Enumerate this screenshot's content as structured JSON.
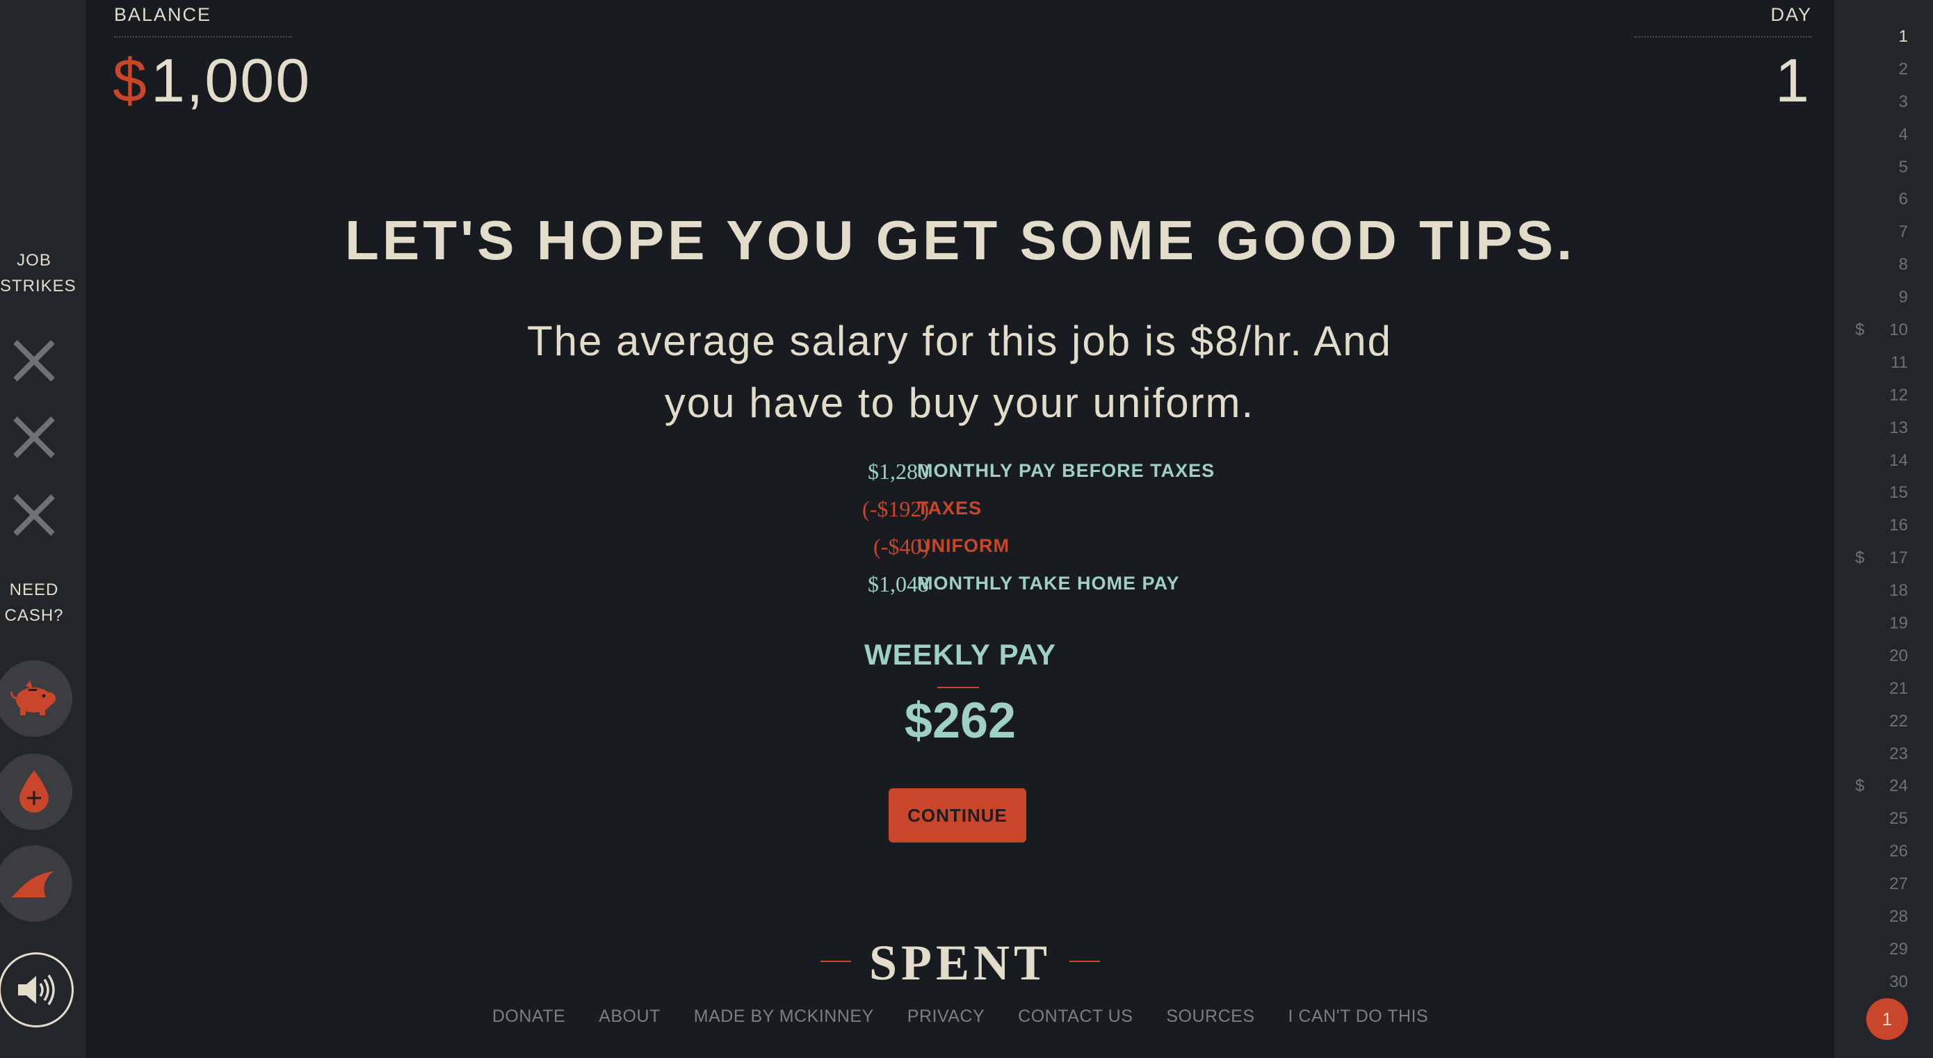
{
  "header": {
    "balance_label": "BALANCE",
    "balance_currency": "$",
    "balance_value": "1,000",
    "day_label": "DAY",
    "day_value": "1"
  },
  "left_rail": {
    "job_strikes_label": "JOB STRIKES",
    "strike_icons": [
      "x-icon",
      "x-icon",
      "x-icon"
    ],
    "need_cash_label": "NEED CASH?",
    "cash_buttons": [
      "piggy-bank-icon",
      "blood-drop-plus-icon",
      "shark-fin-icon"
    ],
    "sound_icon": "speaker-icon"
  },
  "main": {
    "headline": "LET'S HOPE YOU GET SOME GOOD TIPS.",
    "subhead": "The average salary for this job is $8/hr. And you have to buy your uniform.",
    "ledger": [
      {
        "amount": "$1,280",
        "label": "MONTHLY PAY BEFORE TAXES",
        "tone": "teal"
      },
      {
        "amount": "(-$192)",
        "label": "TAXES",
        "tone": "rust"
      },
      {
        "amount": "(-$40)",
        "label": "UNIFORM",
        "tone": "rust"
      },
      {
        "amount": "$1,048",
        "label": "MONTHLY TAKE HOME PAY",
        "tone": "teal"
      }
    ],
    "weekly_label": "WEEKLY PAY",
    "weekly_value": "$262",
    "continue_label": "CONTINUE"
  },
  "logo": "SPENT",
  "footer_links": [
    "DONATE",
    "ABOUT",
    "MADE BY MCKINNEY",
    "PRIVACY",
    "CONTACT US",
    "SOURCES",
    "I CAN'T DO THIS"
  ],
  "days": {
    "items": [
      "1",
      "2",
      "3",
      "4",
      "5",
      "6",
      "7",
      "8",
      "9",
      "10",
      "11",
      "12",
      "13",
      "14",
      "15",
      "16",
      "17",
      "18",
      "19",
      "20",
      "21",
      "22",
      "23",
      "24",
      "25",
      "26",
      "27",
      "28",
      "29",
      "30"
    ],
    "payday_marker": "$",
    "payday_days": [
      "10",
      "17",
      "24"
    ],
    "current_day": "1",
    "badge": "1"
  },
  "colors": {
    "background": "#181b1f",
    "rail": "#22252a",
    "text": "#e4dccb",
    "accent": "#c9462a",
    "teal": "#9ed0c6",
    "muted": "#6f7175"
  }
}
